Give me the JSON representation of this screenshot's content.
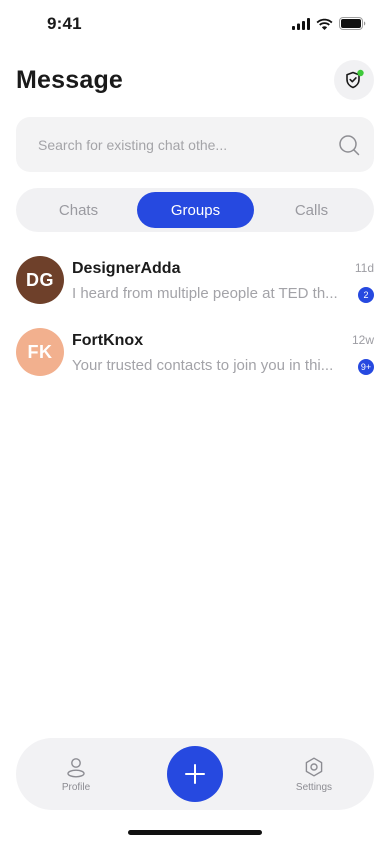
{
  "status_bar": {
    "time": "9:41"
  },
  "header": {
    "title": "Message",
    "shield_icon": "shield-icon",
    "status_dot_color": "#3ec93a"
  },
  "search": {
    "placeholder": "Search for existing chat othe...",
    "value": ""
  },
  "tabs": [
    {
      "label": "Chats",
      "active": false
    },
    {
      "label": "Groups",
      "active": true
    },
    {
      "label": "Calls",
      "active": false
    }
  ],
  "chats": [
    {
      "initials": "DG",
      "name": "DesignerAdda",
      "preview": "I heard from multiple people at TED th...",
      "time": "11d",
      "unread": "2",
      "avatar_color": "#6e402a"
    },
    {
      "initials": "FK",
      "name": "FortKnox",
      "preview": "Your trusted contacts to join you in thi...",
      "time": "12w",
      "unread": "9+",
      "avatar_color": "#f2b08e"
    }
  ],
  "bottom_nav": {
    "profile_label": "Profile",
    "settings_label": "Settings",
    "add_icon": "plus-icon"
  },
  "colors": {
    "accent": "#2649e0"
  }
}
